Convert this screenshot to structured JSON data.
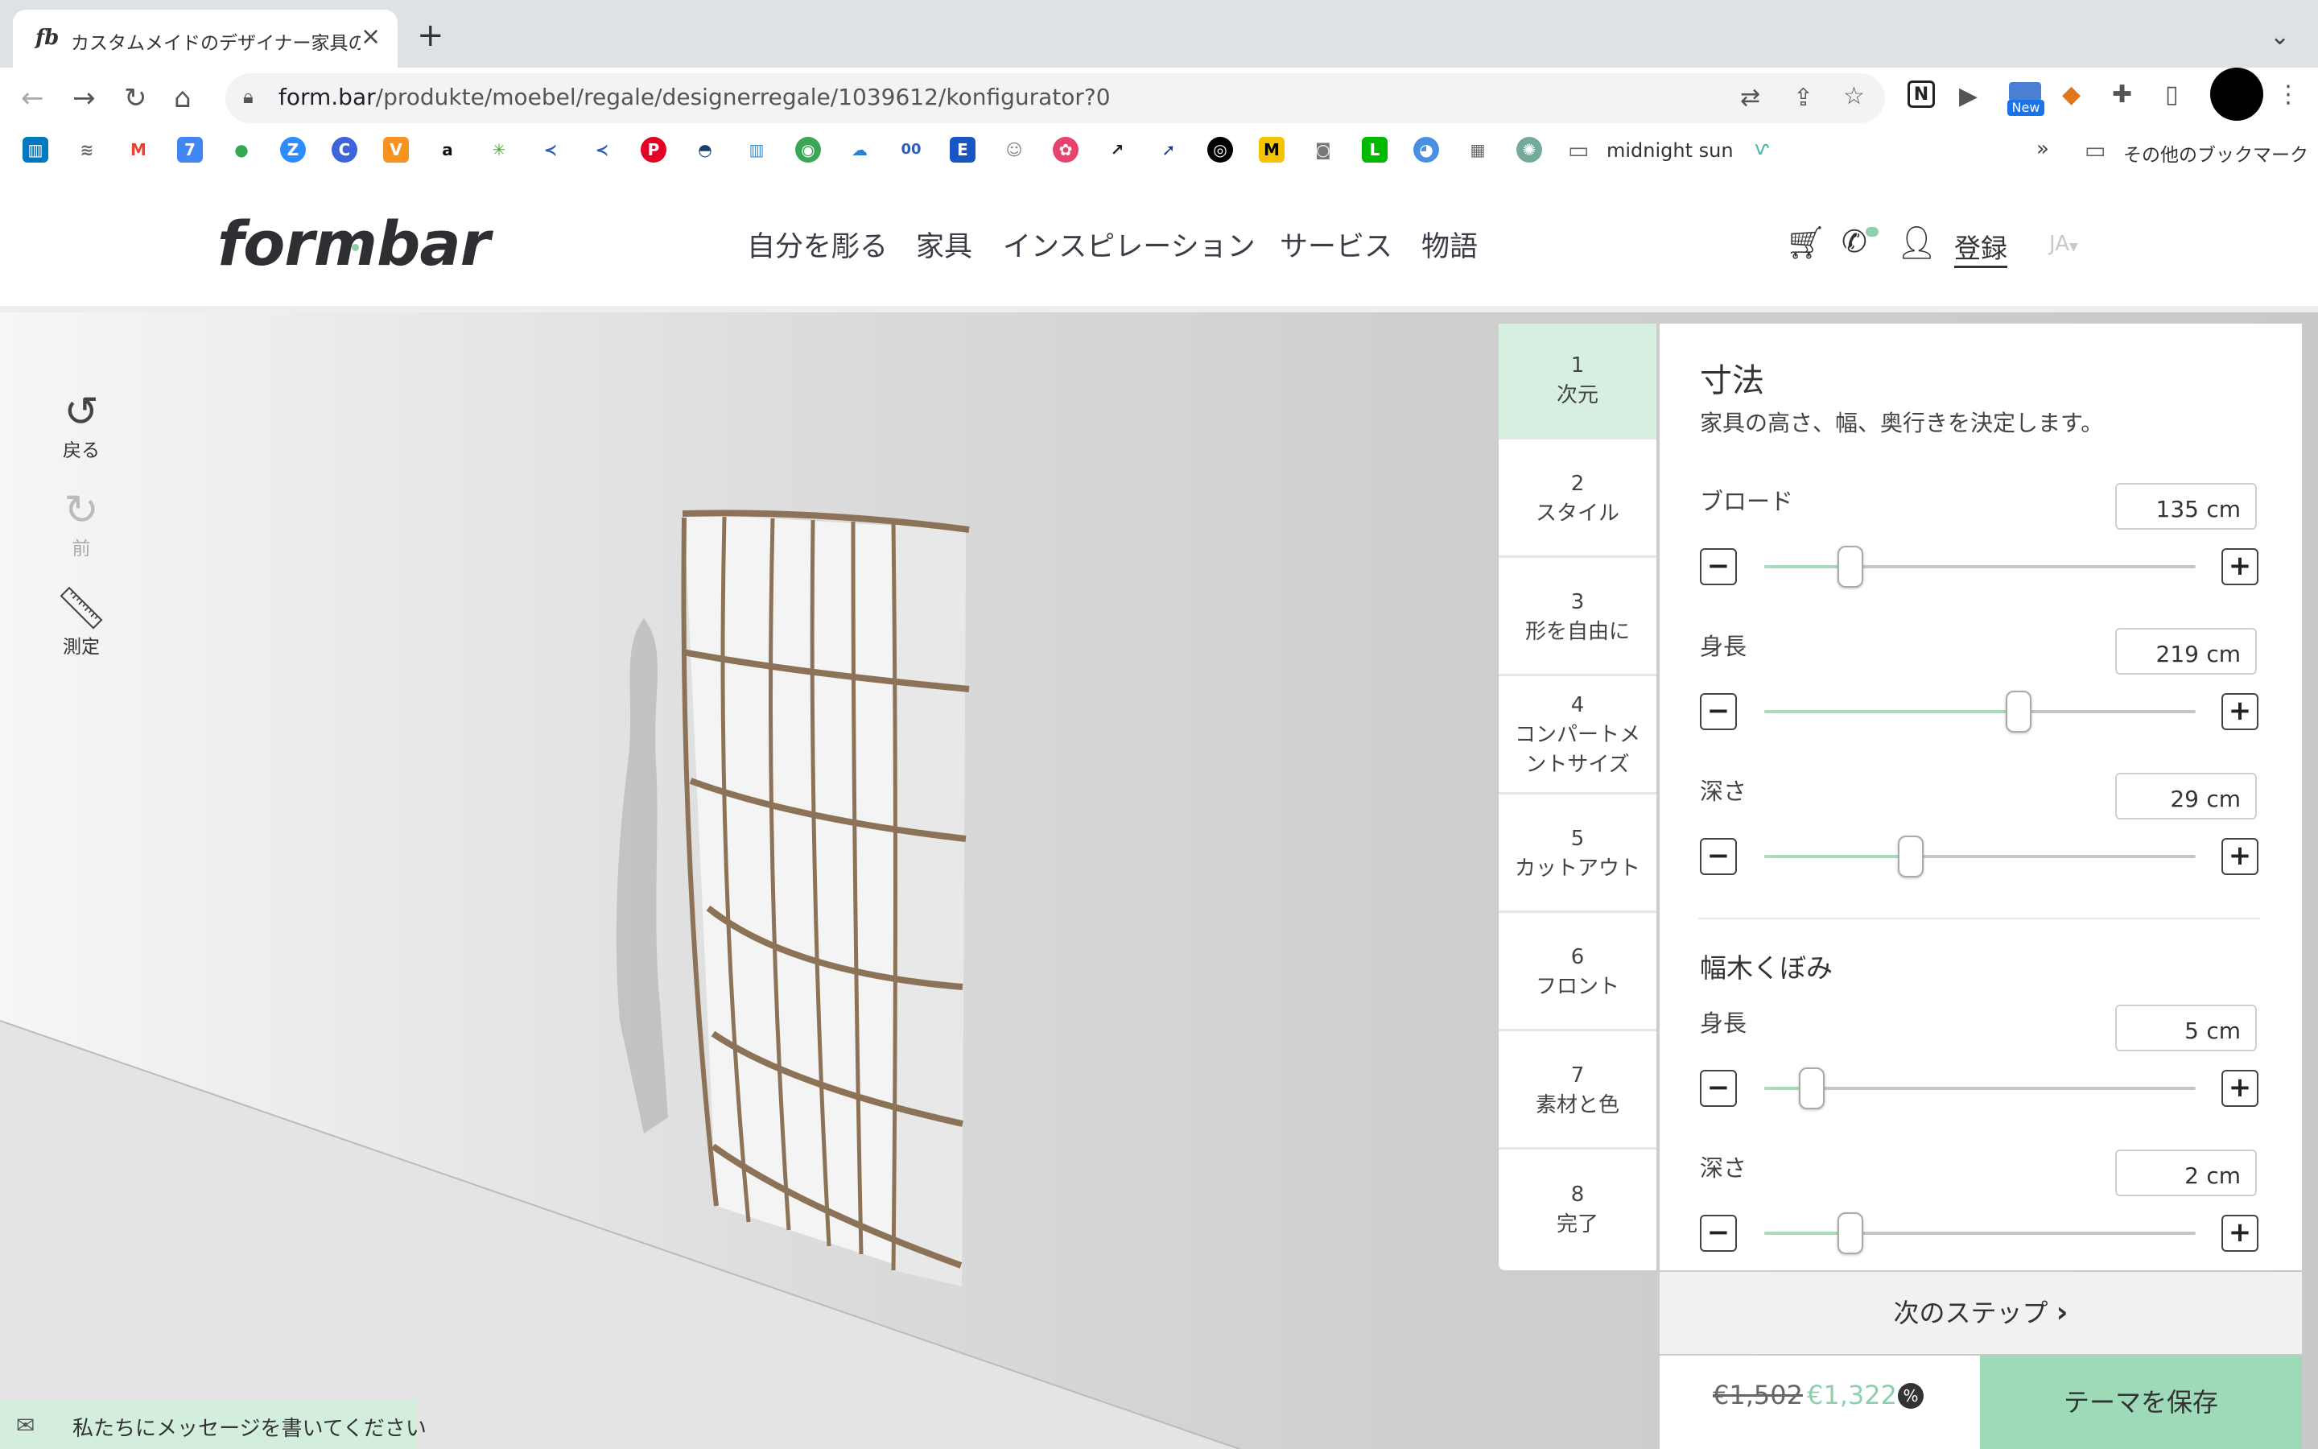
{
  "browser": {
    "tab_title": "カスタムメイドのデザイナー家具の",
    "tab_favicon": "fb",
    "url_host": "form.bar",
    "url_path": "/produkte/moebel/regale/designerregale/1039612/konfigurator?0",
    "new_badge": "New",
    "bookmark_folder": "midnight sun",
    "more": "»",
    "other_bookmarks": "その他のブックマーク"
  },
  "site": {
    "logo": "formbar",
    "nav": [
      "自分を彫る",
      "家具",
      "インスピレーション",
      "サービス",
      "物語"
    ],
    "login": "登録",
    "lang": "JA"
  },
  "tools": {
    "undo": "戻る",
    "redo": "前",
    "measure": "測定"
  },
  "steps": [
    {
      "num": "1",
      "label": "次元"
    },
    {
      "num": "2",
      "label": "スタイル"
    },
    {
      "num": "3",
      "label": "形を自由に"
    },
    {
      "num": "4",
      "label": "コンパートメ\nントサイズ"
    },
    {
      "num": "5",
      "label": "カットアウト"
    },
    {
      "num": "6",
      "label": "フロント"
    },
    {
      "num": "7",
      "label": "素材と色"
    },
    {
      "num": "8",
      "label": "完了"
    }
  ],
  "panel": {
    "title": "寸法",
    "description": "家具の高さ、幅、奥行きを決定します。",
    "sliders": [
      {
        "label": "ブロード",
        "value": "135",
        "unit": "cm",
        "fraction": 0.2
      },
      {
        "label": "身長",
        "value": "219",
        "unit": "cm",
        "fraction": 0.59
      },
      {
        "label": "深さ",
        "value": "29",
        "unit": "cm",
        "fraction": 0.34
      }
    ],
    "section2_title": "幅木くぼみ",
    "sliders2": [
      {
        "label": "身長",
        "value": "5",
        "unit": "cm",
        "fraction": 0.11
      },
      {
        "label": "深さ",
        "value": "2",
        "unit": "cm",
        "fraction": 0.2
      }
    ]
  },
  "footer": {
    "next_step": "次のステップ",
    "old_price": "€1,502",
    "new_price": "€1,322",
    "discount_icon": "%",
    "save": "テーマを保存",
    "message": "私たちにメッセージを書いてください"
  },
  "colors": {
    "accent_green": "#9ed9b8",
    "active_step_bg": "#d6efe0",
    "slider_fill": "#a9dcbd"
  }
}
